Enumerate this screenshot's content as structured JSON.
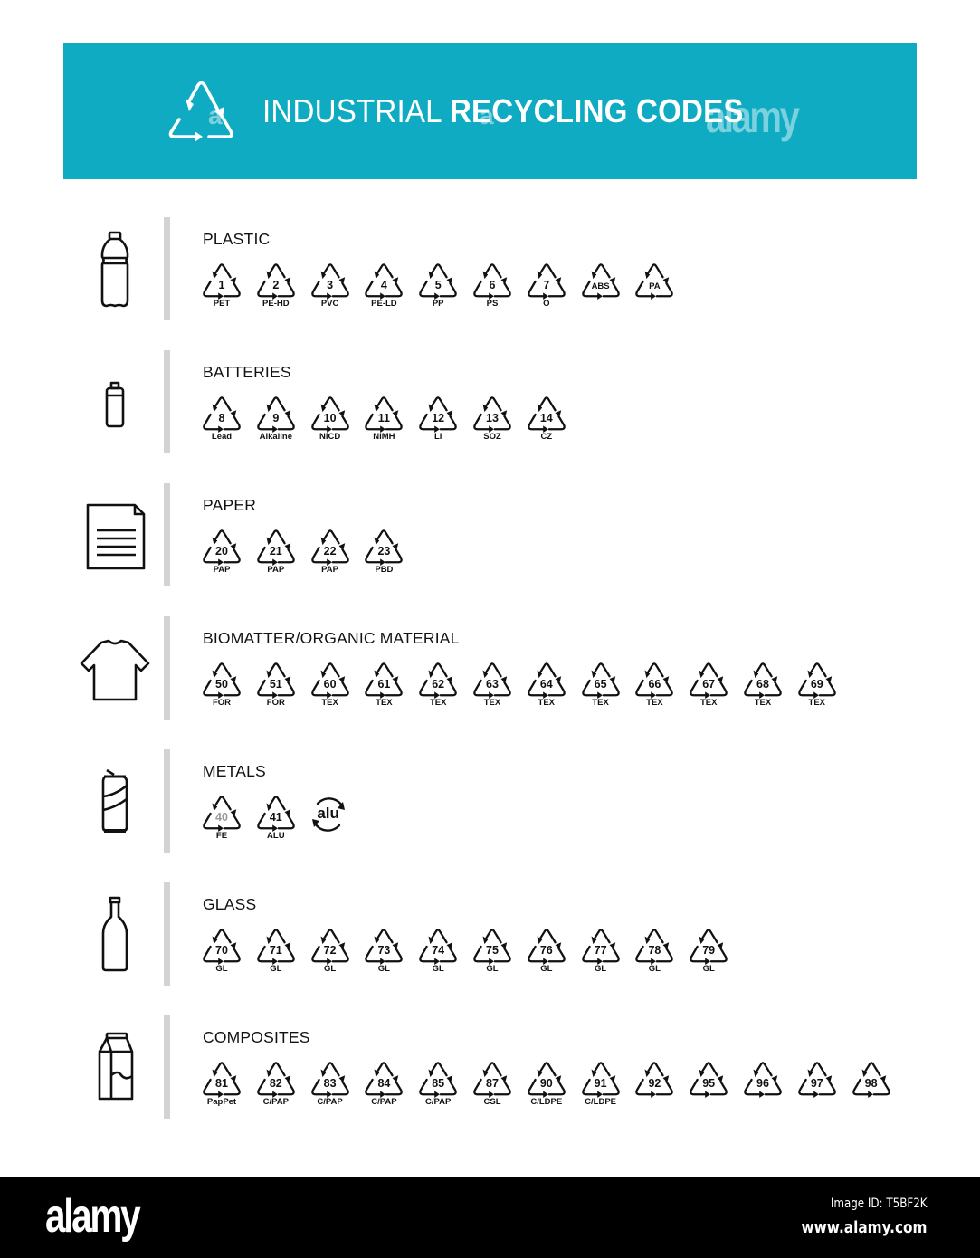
{
  "banner": {
    "title_light": "INDUSTRIAL ",
    "title_bold": "RECYCLING CODES",
    "icon": "recycle-triangle-icon",
    "background_color": "#0fabc3",
    "watermark": "alamy",
    "watermark_letter": "a"
  },
  "sections": [
    {
      "title": "PLASTIC",
      "icon": "plastic-bottle-icon",
      "codes": [
        {
          "num": "1",
          "label": "PET"
        },
        {
          "num": "2",
          "label": "PE-HD"
        },
        {
          "num": "3",
          "label": "PVC"
        },
        {
          "num": "4",
          "label": "PE-LD"
        },
        {
          "num": "5",
          "label": "PP"
        },
        {
          "num": "6",
          "label": "PS"
        },
        {
          "num": "7",
          "label": "O"
        },
        {
          "num": "ABS",
          "label": ""
        },
        {
          "num": "PA",
          "label": ""
        }
      ]
    },
    {
      "title": "BATTERIES",
      "icon": "battery-icon",
      "codes": [
        {
          "num": "8",
          "label": "Lead"
        },
        {
          "num": "9",
          "label": "Alkaline"
        },
        {
          "num": "10",
          "label": "NiCD"
        },
        {
          "num": "11",
          "label": "NiMH"
        },
        {
          "num": "12",
          "label": "Li"
        },
        {
          "num": "13",
          "label": "SOZ"
        },
        {
          "num": "14",
          "label": "CZ"
        }
      ]
    },
    {
      "title": "PAPER",
      "icon": "document-icon",
      "codes": [
        {
          "num": "20",
          "label": "PAP"
        },
        {
          "num": "21",
          "label": "PAP"
        },
        {
          "num": "22",
          "label": "PAP"
        },
        {
          "num": "23",
          "label": "PBD"
        }
      ]
    },
    {
      "title": "BIOMATTER/ORGANIC MATERIAL",
      "icon": "t-shirt-icon",
      "codes": [
        {
          "num": "50",
          "label": "FOR"
        },
        {
          "num": "51",
          "label": "FOR"
        },
        {
          "num": "60",
          "label": "TEX"
        },
        {
          "num": "61",
          "label": "TEX"
        },
        {
          "num": "62",
          "label": "TEX"
        },
        {
          "num": "63",
          "label": "TEX"
        },
        {
          "num": "64",
          "label": "TEX"
        },
        {
          "num": "65",
          "label": "TEX"
        },
        {
          "num": "66",
          "label": "TEX"
        },
        {
          "num": "67",
          "label": "TEX"
        },
        {
          "num": "68",
          "label": "TEX"
        },
        {
          "num": "69",
          "label": "TEX"
        }
      ]
    },
    {
      "title": "METALS",
      "icon": "soda-can-icon",
      "codes": [
        {
          "num": "40",
          "label": "FE"
        },
        {
          "num": "41",
          "label": "ALU"
        }
      ],
      "extra_symbol": {
        "text": "alu",
        "icon": "alu-recycle-icon"
      }
    },
    {
      "title": "GLASS",
      "icon": "glass-bottle-icon",
      "codes": [
        {
          "num": "70",
          "label": "GL"
        },
        {
          "num": "71",
          "label": "GL"
        },
        {
          "num": "72",
          "label": "GL"
        },
        {
          "num": "73",
          "label": "GL"
        },
        {
          "num": "74",
          "label": "GL"
        },
        {
          "num": "75",
          "label": "GL"
        },
        {
          "num": "76",
          "label": "GL"
        },
        {
          "num": "77",
          "label": "GL"
        },
        {
          "num": "78",
          "label": "GL"
        },
        {
          "num": "79",
          "label": "GL"
        }
      ]
    },
    {
      "title": "COMPOSITES",
      "icon": "milk-carton-icon",
      "codes": [
        {
          "num": "81",
          "label": "PapPet"
        },
        {
          "num": "82",
          "label": "C/PAP"
        },
        {
          "num": "83",
          "label": "C/PAP"
        },
        {
          "num": "84",
          "label": "C/PAP"
        },
        {
          "num": "85",
          "label": "C/PAP"
        },
        {
          "num": "87",
          "label": "CSL"
        },
        {
          "num": "90",
          "label": "C/LDPE"
        },
        {
          "num": "91",
          "label": "C/LDPE"
        },
        {
          "num": "92",
          "label": ""
        },
        {
          "num": "95",
          "label": ""
        },
        {
          "num": "96",
          "label": ""
        },
        {
          "num": "97",
          "label": ""
        },
        {
          "num": "98",
          "label": ""
        }
      ]
    }
  ],
  "footer": {
    "logo": "alamy",
    "image_id": "Image ID: T5BF2K",
    "url": "www.alamy.com"
  }
}
